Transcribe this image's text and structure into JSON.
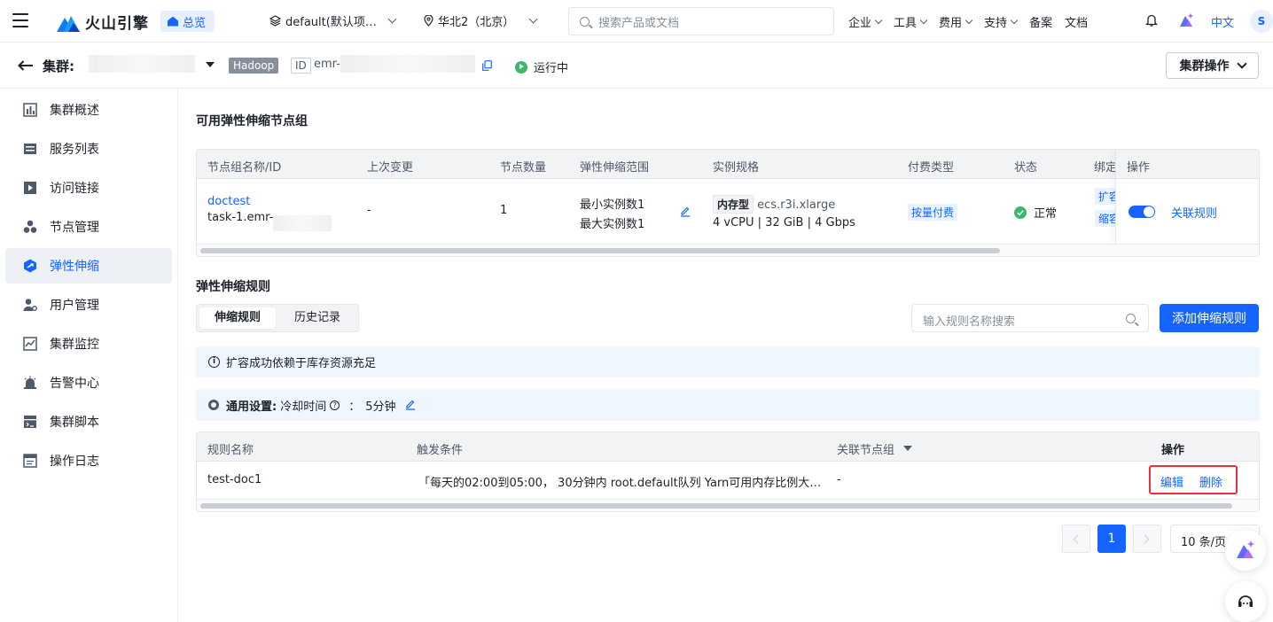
{
  "topbar": {
    "brand": "火山引擎",
    "home": "总览",
    "project": "default(默认项…",
    "region": "华北2（北京）",
    "search_placeholder": "搜索产品或文档",
    "nav": [
      "企业",
      "工具",
      "费用",
      "支持",
      "备案",
      "文档"
    ],
    "lang": "中文",
    "avatar": "S"
  },
  "cluster": {
    "label": "集群:",
    "engine": "Hadoop",
    "id_tag": "ID",
    "id_prefix": "emr-",
    "status": "运行中",
    "ops_button": "集群操作"
  },
  "sidebar": {
    "items": [
      {
        "label": "集群概述",
        "icon": "bar-chart-icon"
      },
      {
        "label": "服务列表",
        "icon": "list-icon"
      },
      {
        "label": "访问链接",
        "icon": "play-link-icon"
      },
      {
        "label": "节点管理",
        "icon": "nodes-icon"
      },
      {
        "label": "弹性伸缩",
        "icon": "autoscale-icon"
      },
      {
        "label": "用户管理",
        "icon": "user-gear-icon"
      },
      {
        "label": "集群监控",
        "icon": "monitor-icon"
      },
      {
        "label": "告警中心",
        "icon": "alarm-icon"
      },
      {
        "label": "集群脚本",
        "icon": "script-icon"
      },
      {
        "label": "操作日志",
        "icon": "log-icon"
      }
    ],
    "active_index": 4
  },
  "groups": {
    "title": "可用弹性伸缩节点组",
    "columns": [
      "节点组名称/ID",
      "上次变更",
      "节点数量",
      "弹性伸缩范围",
      "实例规格",
      "付费类型",
      "状态",
      "绑定",
      "操作"
    ],
    "row": {
      "name": "doctest",
      "id_prefix": "task-1.emr-",
      "last_change": "-",
      "count": "1",
      "range_min": "最小实例数1",
      "range_max": "最大实例数1",
      "spec_tag": "内存型",
      "spec": "ecs.r3i.xlarge",
      "spec_detail": "4 vCPU | 32 GiB | 4 Gbps",
      "pay": "按量付费",
      "status": "正常",
      "bind1": "扩容",
      "bind2": "缩容",
      "toggle_on": true,
      "action": "关联规则"
    }
  },
  "rules": {
    "title": "弹性伸缩规则",
    "tabs": [
      "伸缩规则",
      "历史记录"
    ],
    "search_placeholder": "输入规则名称搜索",
    "add_button": "添加伸缩规则",
    "info": "扩容成功依赖于库存资源充足",
    "general_label": "通用设置:",
    "cooldown_label": "冷却时间",
    "cooldown_value": "5分钟",
    "columns": [
      "规则名称",
      "触发条件",
      "关联节点组",
      "操作"
    ],
    "row": {
      "name": "test-doc1",
      "condition": "「每天的02:00到05:00， 30分钟内 root.default队列 Yarn可用内存比例大…",
      "group": "-",
      "edit": "编辑",
      "delete": "删除"
    }
  },
  "pagination": {
    "current": "1",
    "page_size": "10 条/页"
  },
  "colors": {
    "accent": "#1664ff",
    "success": "#3ab76a",
    "highlight": "#e5323b"
  }
}
